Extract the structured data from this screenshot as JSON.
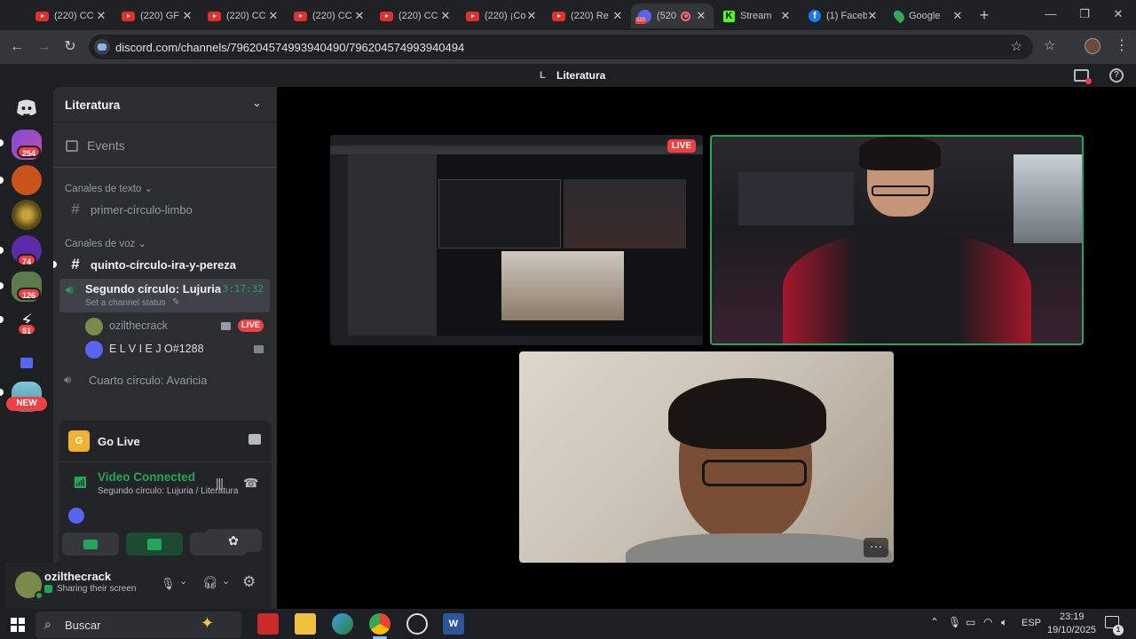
{
  "browser": {
    "tabs": [
      {
        "label": "(220) CC",
        "icon": "youtube-icon"
      },
      {
        "label": "(220) GF",
        "icon": "youtube-icon"
      },
      {
        "label": "(220) CC",
        "icon": "youtube-icon"
      },
      {
        "label": "(220) CC",
        "icon": "youtube-icon"
      },
      {
        "label": "(220) CC",
        "icon": "youtube-icon"
      },
      {
        "label": "(220) ¡Co",
        "icon": "youtube-icon"
      },
      {
        "label": "(220) Re",
        "icon": "youtube-icon"
      },
      {
        "label": "(520",
        "icon": "discord-icon",
        "badge": "520"
      },
      {
        "label": "Stream",
        "icon": "kick-icon"
      },
      {
        "label": "(1) Faceb",
        "icon": "facebook-icon"
      },
      {
        "label": "Google",
        "icon": "maps-icon"
      }
    ],
    "url": "discord.com/channels/796204574993940490/796204574993940494"
  },
  "discord": {
    "topbar_title": "Literatura",
    "topbar_letter": "L",
    "server_name": "Literatura",
    "guild_badges": [
      "254",
      "74",
      "126",
      "51"
    ],
    "new_label": "NEW",
    "events_label": "Events",
    "text_category": "Canales de texto",
    "text_channel": "primer-círculo-limbo",
    "voice_category": "Canales de voz",
    "voice_text_channel": "quinto-círculo-ira-y-pereza",
    "active_voice_channel": "Segundo círculo: Lujuria",
    "active_voice_timer": "3:17:32",
    "channel_status_placeholder": "Set a channel status",
    "voice_members": [
      {
        "name": "ozilthecrack",
        "live": "LIVE"
      },
      {
        "name": "E L V I E J O#1288"
      }
    ],
    "other_voice_channel": "Cuarto círculo: Avaricia",
    "go_live_label": "Go Live",
    "video_connected_label": "Video Connected",
    "connection_detail": "Segundo círculo: Lujuria / Literatura",
    "user": {
      "name": "ozilthecrack",
      "status": "Sharing their screen"
    },
    "stream_live_label": "LIVE"
  },
  "taskbar": {
    "search_placeholder": "Buscar",
    "language": "ESP",
    "time": "23:19",
    "date": "19/10/2025",
    "notification_count": "1"
  },
  "colors": {
    "accent_green": "#23a55a",
    "live_red": "#f23f43",
    "blurple": "#5865f2"
  }
}
